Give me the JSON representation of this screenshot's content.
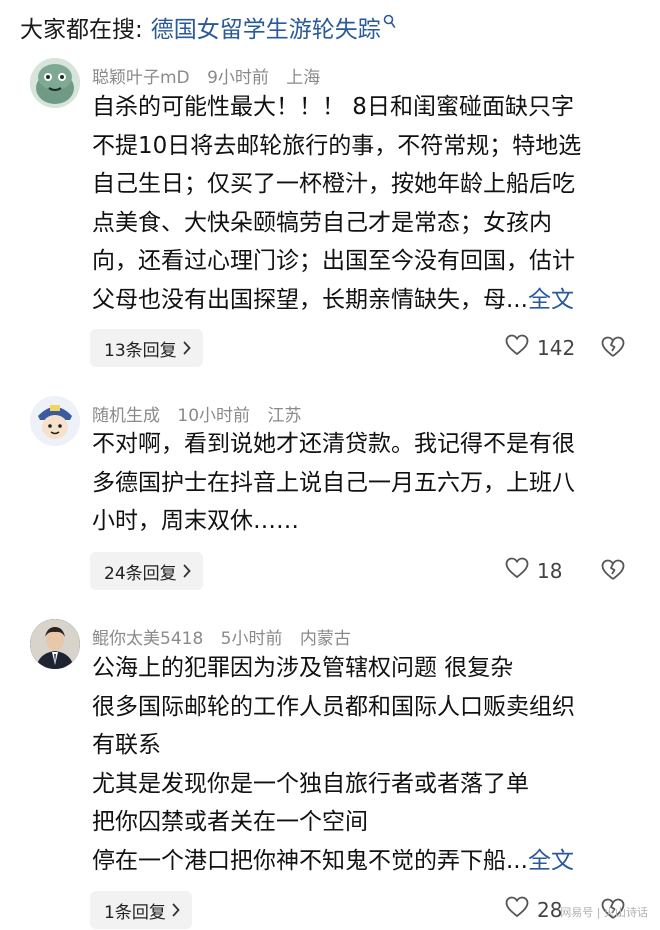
{
  "search": {
    "prefix": "大家都在搜:",
    "query": "德国女留学生游轮失踪"
  },
  "comments": [
    {
      "username": "聪颖叶子mD",
      "time": "9小时前",
      "location": "上海",
      "lines": [
        "自杀的可能性最大！！！ 8日和闺蜜碰面缺只字",
        "不提10日将去邮轮旅行的事，不符常规；特地选",
        "自己生日；仅买了一杯橙汁，按她年龄上船后吃",
        "点美食、大快朵颐犒劳自己才是常态；女孩内",
        "向，还看过心理门诊；出国至今没有回国，估计",
        "父母也没有出国探望，长期亲情缺失，母..."
      ],
      "fulltext": "全文",
      "replies": "13条回复",
      "likes": "142"
    },
    {
      "username": "随机生成",
      "time": "10小时前",
      "location": "江苏",
      "lines": [
        "不对啊，看到说她才还清贷款。我记得不是有很",
        "多德国护士在抖音上说自己一月五六万，上班八",
        "小时，周末双休……"
      ],
      "replies": "24条回复",
      "likes": "18"
    },
    {
      "username": "鲲你太美5418",
      "time": "5小时前",
      "location": "内蒙古",
      "lines": [
        "公海上的犯罪因为涉及管辖权问题 很复杂",
        "很多国际邮轮的工作人员都和国际人口贩卖组织",
        "有联系",
        "尤其是发现你是一个独自旅行者或者落了单",
        "把你囚禁或者关在一个空间",
        "停在一个港口把你神不知鬼不觉的弄下船..."
      ],
      "fulltext": "全文",
      "replies": "1条回复",
      "likes": "28"
    }
  ],
  "watermark": "网易号 | 火山诗话"
}
